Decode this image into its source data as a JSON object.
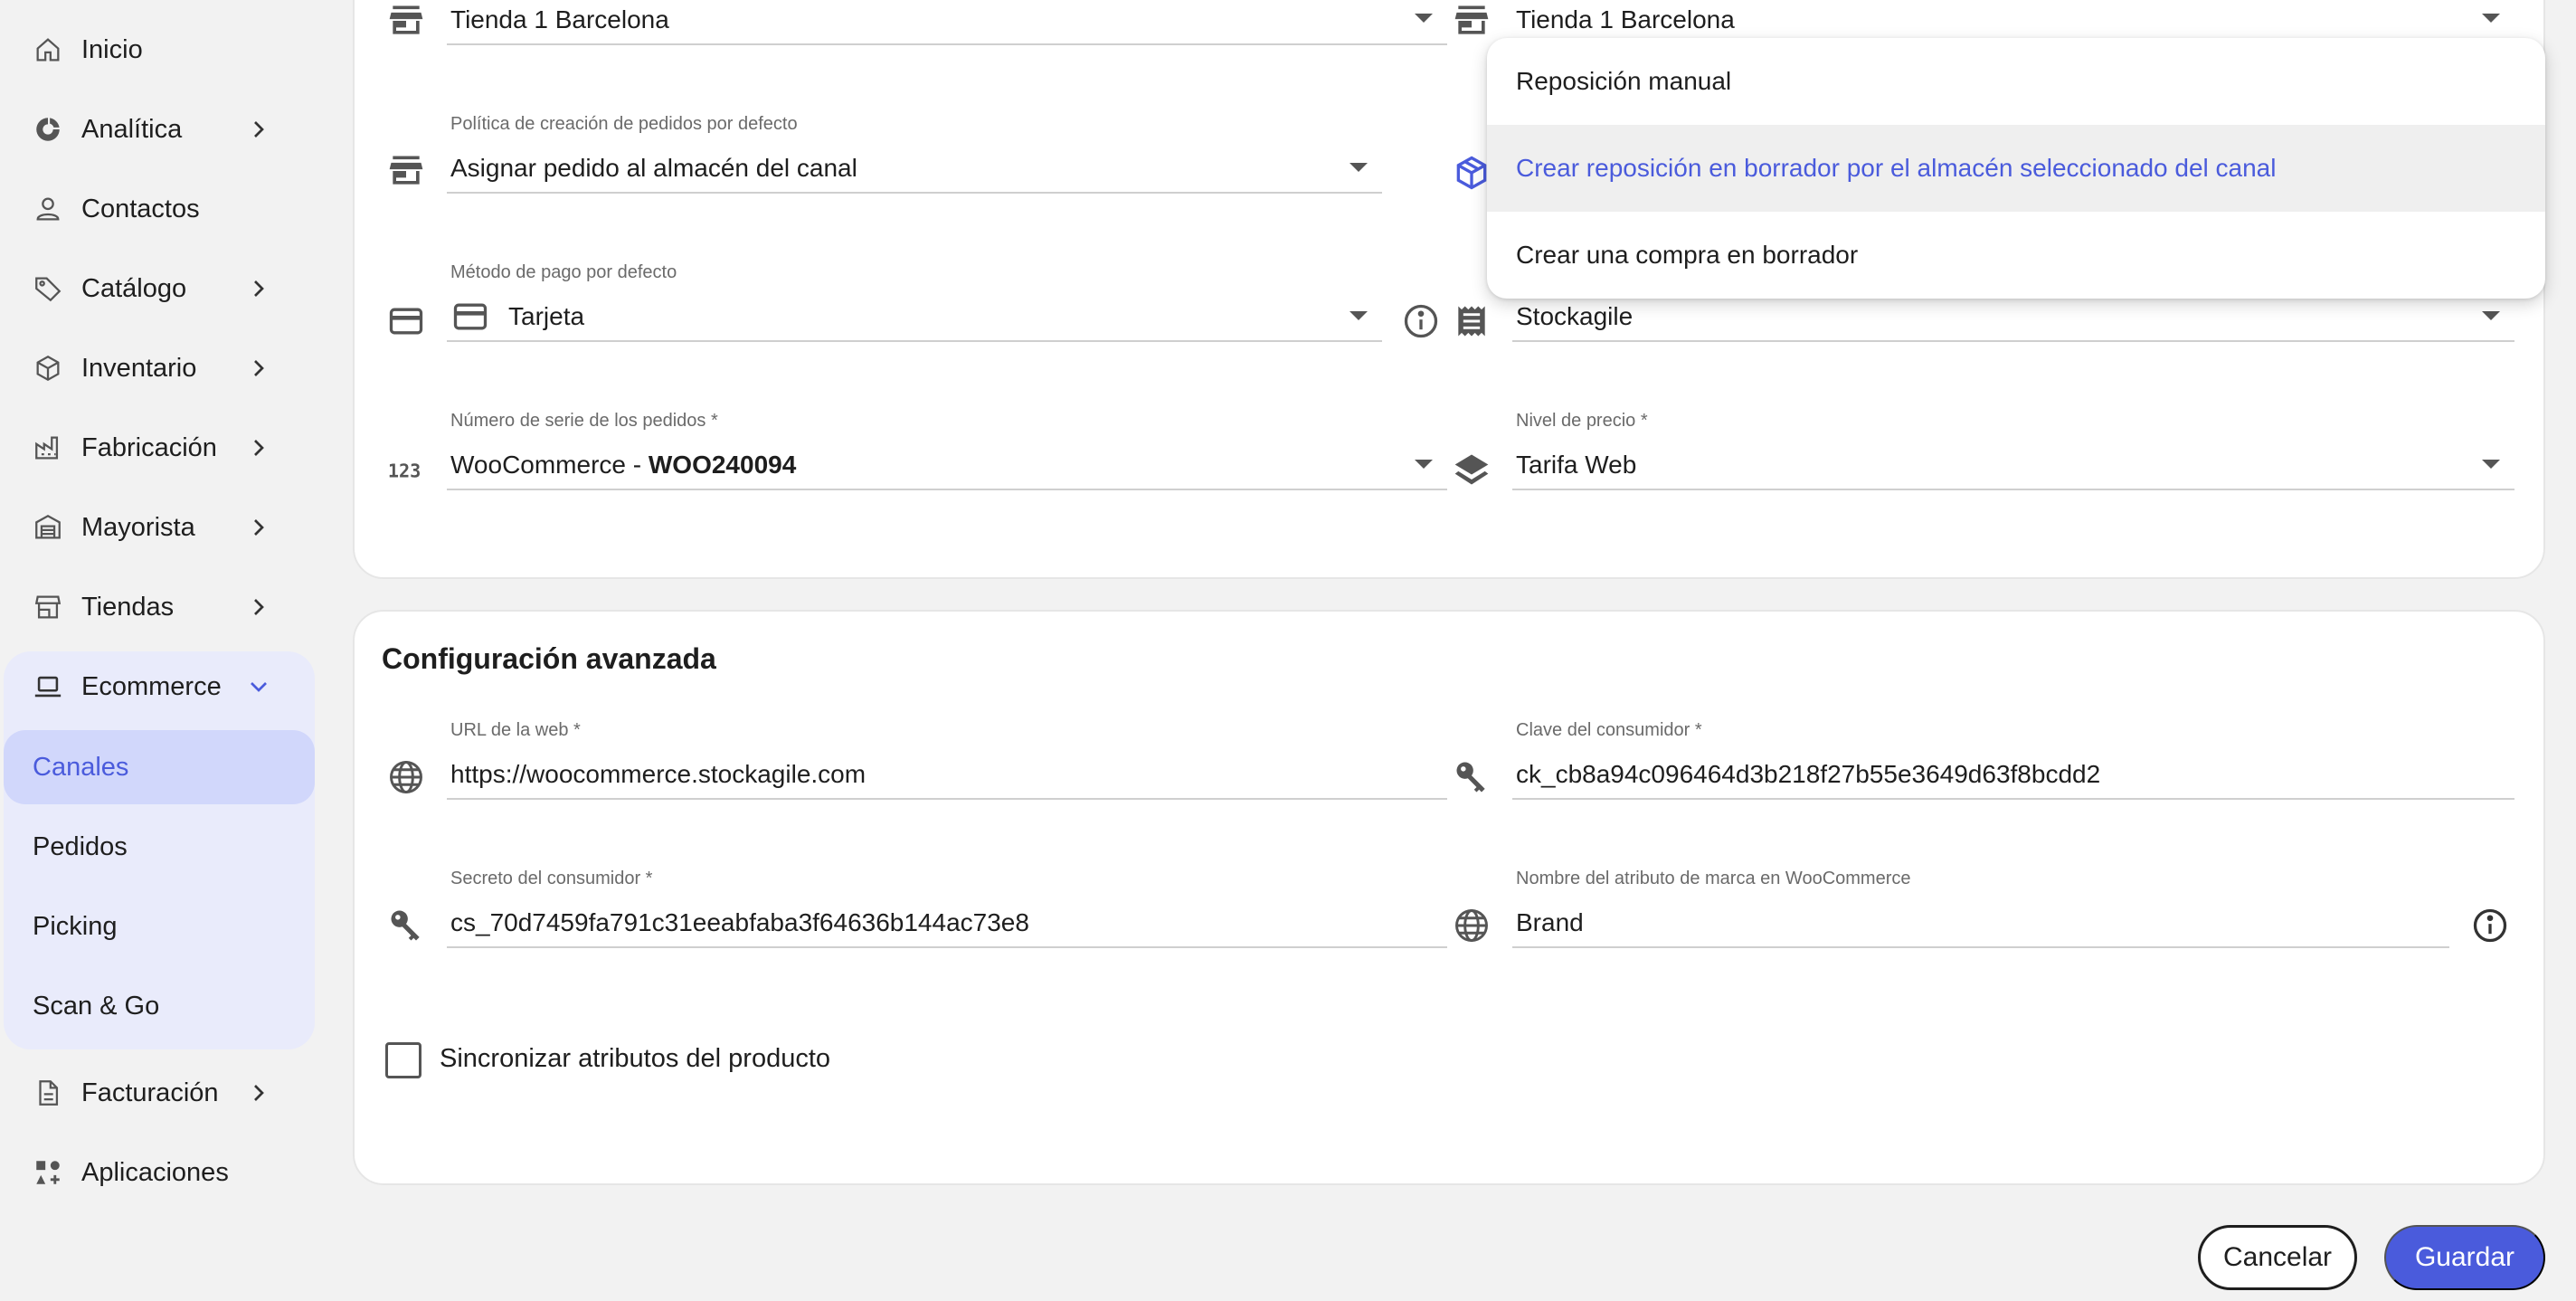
{
  "sidebar": {
    "items": [
      {
        "label": "Inicio",
        "icon": "home-icon",
        "chevron": false
      },
      {
        "label": "Analítica",
        "icon": "analytics-icon",
        "chevron": true
      },
      {
        "label": "Contactos",
        "icon": "person-icon",
        "chevron": false
      },
      {
        "label": "Catálogo",
        "icon": "tag-icon",
        "chevron": true
      },
      {
        "label": "Inventario",
        "icon": "box-icon",
        "chevron": true
      },
      {
        "label": "Fabricación",
        "icon": "factory-icon",
        "chevron": true
      },
      {
        "label": "Mayorista",
        "icon": "warehouse-icon",
        "chevron": true
      },
      {
        "label": "Tiendas",
        "icon": "store-icon",
        "chevron": true
      },
      {
        "label": "Ecommerce",
        "icon": "laptop-icon",
        "chevron": true,
        "expanded": true
      },
      {
        "label": "Facturación",
        "icon": "document-icon",
        "chevron": true
      },
      {
        "label": "Aplicaciones",
        "icon": "apps-icon",
        "chevron": false
      }
    ],
    "ecommerce_sub": [
      "Canales",
      "Pedidos",
      "Picking",
      "Scan & Go"
    ],
    "active_sub": "Canales"
  },
  "form": {
    "store_left": {
      "value": "Tienda 1 Barcelona"
    },
    "store_right": {
      "value": "Tienda 1 Barcelona"
    },
    "order_policy": {
      "label": "Política de creación de pedidos por defecto",
      "value": "Asignar pedido al almacén del canal"
    },
    "payment_method": {
      "label": "Método de pago por defecto",
      "value": "Tarjeta"
    },
    "right_select": {
      "value": "Stockagile"
    },
    "order_series": {
      "label": "Número de serie de los pedidos *",
      "value_prefix": "WooCommerce - ",
      "value_bold": "WOO240094"
    },
    "price_level": {
      "label": "Nivel de precio *",
      "value": "Tarifa Web"
    }
  },
  "dropdown": {
    "options": [
      "Reposición manual",
      "Crear reposición en borrador por el almacén seleccionado del canal",
      "Crear una compra en borrador"
    ],
    "selected_index": 1
  },
  "advanced": {
    "title": "Configuración avanzada",
    "url": {
      "label": "URL de la web *",
      "value": "https://woocommerce.stockagile.com"
    },
    "consumer_key": {
      "label": "Clave del consumidor *",
      "value": "ck_cb8a94c096464d3b218f27b55e3649d63f8bcdd2"
    },
    "consumer_secret": {
      "label": "Secreto del consumidor *",
      "value": "cs_70d7459fa791c31eeabfaba3f64636b144ac73e8"
    },
    "brand_attr": {
      "label": "Nombre del atributo de marca en WooCommerce",
      "value": "Brand"
    },
    "sync_label": "Sincronizar atributos del producto",
    "sync_checked": false
  },
  "actions": {
    "cancel": "Cancelar",
    "save": "Guardar"
  },
  "colors": {
    "accent": "#4a5bdc",
    "active_bg": "#d1d7fb",
    "group_bg": "#e9ebfb"
  }
}
